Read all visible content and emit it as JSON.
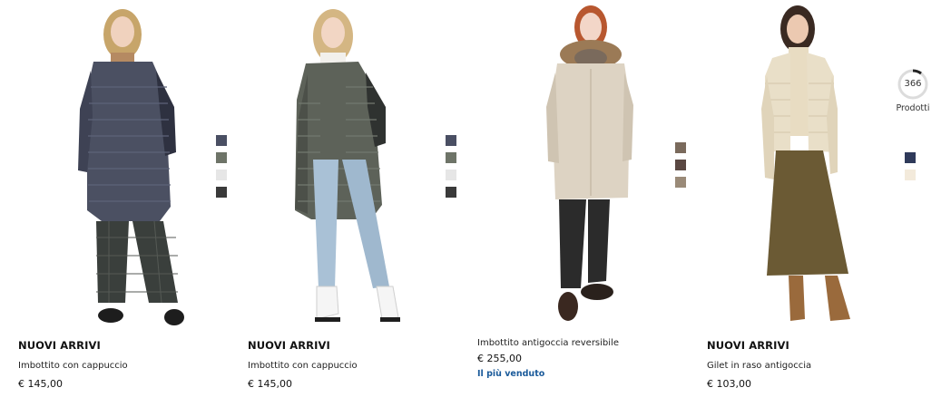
{
  "products": [
    {
      "tag": "NUOVI ARRIVI",
      "name": "Imbottito con cappuccio",
      "price": "€ 145,00",
      "badge": "",
      "swatches": [
        "#4a4f63",
        "#6e7468",
        "#e6e6e6",
        "#3a3a3a"
      ],
      "garment_color": "#4b5062"
    },
    {
      "tag": "NUOVI ARRIVI",
      "name": "Imbottito con cappuccio",
      "price": "€ 145,00",
      "badge": "",
      "swatches": [
        "#4a4f63",
        "#6e7468",
        "#e6e6e6",
        "#3a3a3a"
      ],
      "garment_color": "#5d6259"
    },
    {
      "tag": "",
      "name": "Imbottito antigoccia reversibile",
      "price": "€ 255,00",
      "badge": "Il più venduto",
      "swatches": [
        "#7a6a5c",
        "#5a4842",
        "#9a8a78"
      ],
      "garment_color": "#ddd3c3"
    },
    {
      "tag": "NUOVI ARRIVI",
      "name": "Gilet in raso antigoccia",
      "price": "€ 103,00",
      "badge": "",
      "swatches": [
        "#2f3a5a",
        "#f3eadb"
      ],
      "garment_color": "#e9dfc8"
    }
  ],
  "counter": {
    "count": "366",
    "label": "Prodotti"
  },
  "colors": {
    "badge_blue": "#1a5a9a"
  }
}
